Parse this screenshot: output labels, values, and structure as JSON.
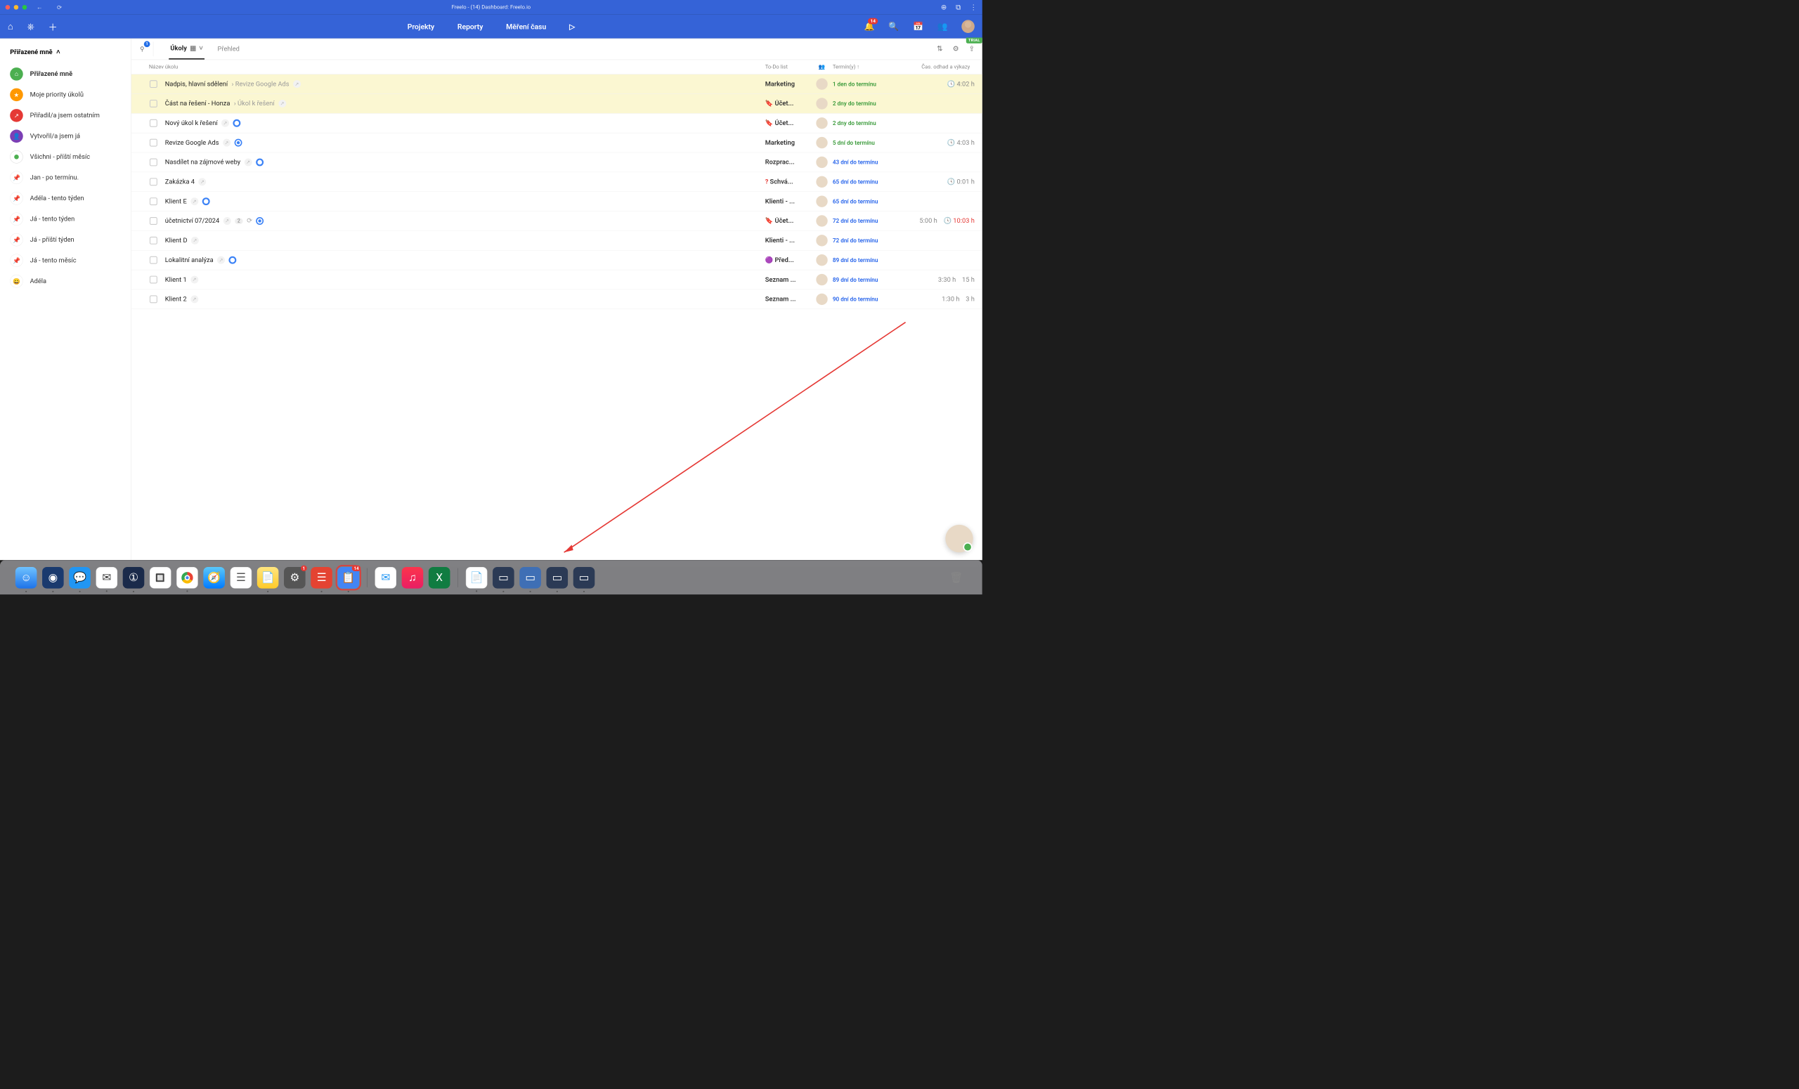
{
  "window": {
    "title": "Freelo - (14) Dashboard: Freelo.io"
  },
  "trial_badge": "TRIAL",
  "nav": {
    "projects": "Projekty",
    "reports": "Reporty",
    "timing": "Měření času",
    "bell_count": "14"
  },
  "sidebar": {
    "header": "Přiřazené mně",
    "items": [
      {
        "label": "Přiřazené mně",
        "icon": "home",
        "cls": "ic-green",
        "sel": true
      },
      {
        "label": "Moje priority úkolů",
        "icon": "star",
        "cls": "ic-orange"
      },
      {
        "label": "Přiřadil/a jsem ostatním",
        "icon": "share",
        "cls": "ic-red"
      },
      {
        "label": "Vytvořil/a jsem já",
        "icon": "user",
        "cls": "ic-purple"
      },
      {
        "label": "Všichni - příští měsíc",
        "icon": "dot",
        "cls": "ic-dot"
      },
      {
        "label": "Jan - po termínu.",
        "icon": "pin",
        "cls": "ic-pin"
      },
      {
        "label": "Adéla - tento týden",
        "icon": "pin",
        "cls": "ic-pin"
      },
      {
        "label": "Já - tento týden",
        "icon": "pin",
        "cls": "ic-pin"
      },
      {
        "label": "Já - příští týden",
        "icon": "pin",
        "cls": "ic-pin"
      },
      {
        "label": "Já - tento měsíc",
        "icon": "pin",
        "cls": "ic-pin"
      },
      {
        "label": "Adéla",
        "icon": "smile",
        "cls": "ic-smile"
      }
    ]
  },
  "tabs": {
    "filter_count": "1",
    "tasks": "Úkoly",
    "overview": "Přehled"
  },
  "columns": {
    "name": "Název úkolu",
    "todo": "To-Do list",
    "terms": "Termín(y) ↑",
    "time": "Čas. odhad a výkazy"
  },
  "rows": [
    {
      "hl": true,
      "name": "Nadpis, hlavní sdělení",
      "sub": "Revize Google Ads",
      "todo": "Marketing",
      "term": "1 den do termínu",
      "termc": "g",
      "time2": "4:02 h",
      "clk2": true
    },
    {
      "hl": true,
      "name": "Část na řešení - Honza",
      "sub": "Úkol k řešení",
      "todo": "Účet...",
      "todoic": "🔖",
      "term": "2 dny do termínu",
      "termc": "g"
    },
    {
      "name": "Nový úkol k řešení",
      "ring": true,
      "todo": "Účet...",
      "todoic": "🔖",
      "term": "2 dny do termínu",
      "termc": "g"
    },
    {
      "name": "Revize Google Ads",
      "dotring": true,
      "todo": "Marketing",
      "term": "5 dní do termínu",
      "termc": "g",
      "time2": "4:03 h",
      "clk2": true
    },
    {
      "name": "Nasdílet na zájmové weby",
      "ring": true,
      "todo": "Rozprac...",
      "term": "43 dní do termínu",
      "termc": "b"
    },
    {
      "name": "Zakázka 4",
      "todo": "Schvá...",
      "todoic": "?",
      "todoicred": true,
      "term": "65 dní do termínu",
      "termc": "b",
      "time2": "0:01 h",
      "clk2": true
    },
    {
      "name": "Klient E",
      "ring": true,
      "todo": "Klienti - ...",
      "term": "65 dní do termínu",
      "termc": "b"
    },
    {
      "name": "účetnictví 07/2024",
      "count": "2",
      "refresh": true,
      "dotring": true,
      "todo": "Účet...",
      "todoic": "🔖",
      "term": "72 dní do termínu",
      "termc": "b",
      "time1": "5:00 h",
      "time2": "10:03 h",
      "clk2": true,
      "clk2red": true
    },
    {
      "name": "Klient D",
      "todo": "Klienti - ...",
      "term": "72 dní do termínu",
      "termc": "b"
    },
    {
      "name": "Lokalitní analýza",
      "ring": true,
      "todo": "Před...",
      "todoic": "🟣",
      "term": "89 dní do termínu",
      "termc": "b"
    },
    {
      "name": "Klient 1",
      "todo": "Seznam ...",
      "term": "89 dní do termínu",
      "termc": "b",
      "time1": "3:30 h",
      "time2": "15 h"
    },
    {
      "name": "Klient 2",
      "todo": "Seznam ...",
      "term": "90 dní do termínu",
      "termc": "b",
      "time1": "1:30 h",
      "time2": "3 h"
    }
  ],
  "dock": {
    "badge_todoist": "1",
    "badge_freelo": "14"
  }
}
